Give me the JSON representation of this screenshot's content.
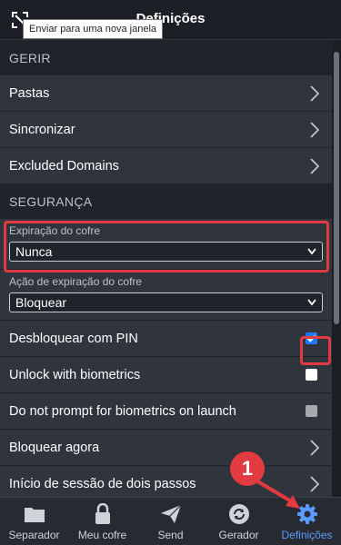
{
  "header": {
    "title": "Definições",
    "tooltip": "Enviar para uma nova janela",
    "popout_icon": "popout-icon"
  },
  "sections": {
    "manage_title": "GERIR",
    "security_title": "SEGURANÇA"
  },
  "manage_items": [
    {
      "label": "Pastas"
    },
    {
      "label": "Sincronizar"
    },
    {
      "label": "Excluded Domains"
    }
  ],
  "vault_timeout": {
    "label": "Expiração do cofre",
    "value": "Nunca"
  },
  "vault_timeout_action": {
    "label": "Ação de expiração do cofre",
    "value": "Bloquear"
  },
  "security_items": {
    "pin": {
      "label": "Desbloquear com PIN",
      "checked": true
    },
    "biometrics": {
      "label": "Unlock with biometrics",
      "checked": false
    },
    "no_prompt": {
      "label": "Do not prompt for biometrics on launch",
      "checked": false,
      "disabled": true
    },
    "lock_now": {
      "label": "Bloquear agora"
    },
    "two_step": {
      "label": "Início de sessão de dois passos"
    }
  },
  "tabs": [
    {
      "label": "Separador",
      "icon": "folder-icon"
    },
    {
      "label": "Meu cofre",
      "icon": "lock-icon"
    },
    {
      "label": "Send",
      "icon": "send-icon"
    },
    {
      "label": "Gerador",
      "icon": "refresh-icon"
    },
    {
      "label": "Definições",
      "icon": "gear-icon",
      "active": true
    }
  ],
  "annotation": {
    "step": "1"
  },
  "colors": {
    "accent": "#5a9bff",
    "highlight": "#e23a41",
    "checkbox_checked": "#1c7bff",
    "background": "#1f242a",
    "row": "#2f343d"
  }
}
